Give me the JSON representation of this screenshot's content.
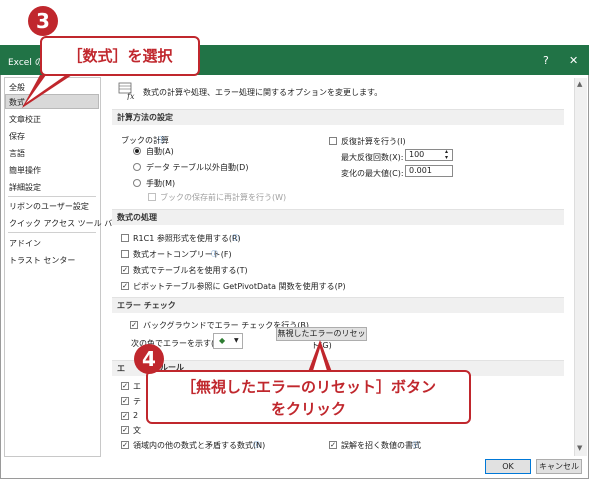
{
  "window": {
    "title": "Excel のオプ",
    "help": "?",
    "close": "✕"
  },
  "sidebar": {
    "items": [
      "全般",
      "数式",
      "文章校正",
      "保存",
      "言語",
      "簡単操作",
      "詳細設定",
      "リボンのユーザー設定",
      "クイック アクセス ツール バー",
      "アドイン",
      "トラスト センター"
    ]
  },
  "content": {
    "description": "数式の計算や処理、エラー処理に関するオプションを変更します。",
    "calc_section": {
      "header": "計算方法の設定",
      "workbook_calc": "ブックの計算",
      "auto": "自動(A)",
      "auto_except_tables": "データ テーブル以外自動(D)",
      "manual": "手動(M)",
      "recalc_before_save": "ブックの保存前に再計算を行う(W)",
      "iterative": "反復計算を行う(I)",
      "max_iterations_label": "最大反復回数(X):",
      "max_iterations_value": "100",
      "max_change_label": "変化の最大値(C):",
      "max_change_value": "0.001"
    },
    "formula_section": {
      "header": "数式の処理",
      "r1c1": "R1C1 参照形式を使用する(R)",
      "autocomplete": "数式オートコンプリート(F)",
      "table_names": "数式でテーブル名を使用する(T)",
      "getpivot": "ピボットテーブル参照に GetPivotData 関数を使用する(P)"
    },
    "error_section": {
      "header": "エラー チェック",
      "background": "バックグラウンドでエラー チェックを行う(B)",
      "color_label": "次の色でエラーを示す(E):",
      "reset_button": "無視したエラーのリセット(G)"
    },
    "rules_section": {
      "header_partial": "エ",
      "header_partial2": "ルール",
      "item_e": "エ",
      "item_te": "テ",
      "item_2": "2",
      "item_bun": "文",
      "inconsistent": "領域内の他の数式と矛盾する数式(N)",
      "misleading_format": "誤解を招く数値の書式"
    }
  },
  "footer": {
    "ok": "OK",
    "cancel": "キャンセル"
  },
  "callouts": {
    "step3_number": "3",
    "step3_text": "［数式］を選択",
    "step4_number": "4",
    "step4_line1": "［無視したエラーのリセット］ボタン",
    "step4_line2": "をクリック"
  },
  "colors": {
    "accent": "#c0272d",
    "titlebar": "#217346"
  }
}
